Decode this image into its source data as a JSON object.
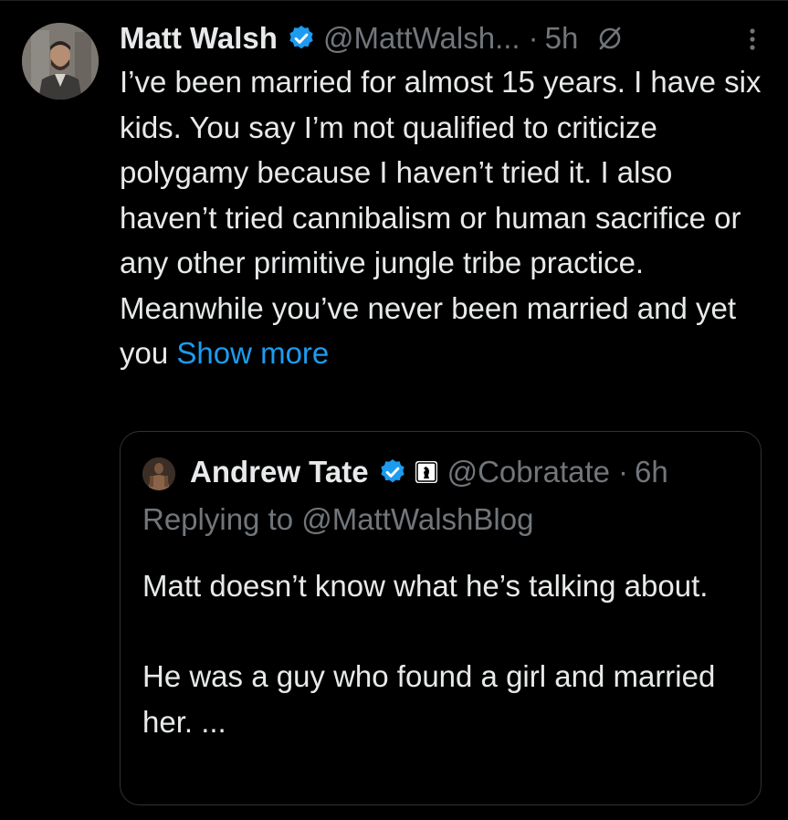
{
  "tweet": {
    "author_name": "Matt Walsh",
    "author_handle": "@MattWalsh...",
    "separator": "·",
    "time": "5h",
    "text": "I’ve been married for almost 15 years. I have six kids. You say I’m not qualified to criticize polygamy because I haven’t tried it. I also haven’t tried cannibalism or human sacrifice or any other primitive jungle tribe practice. Meanwhile you’ve never been married and yet you ",
    "show_more": "Show more",
    "icons": {
      "verified": "verified-badge-icon",
      "no_entry": "no-entry-icon",
      "more": "more-vertical-icon"
    }
  },
  "quoted_tweet": {
    "author_name": "Andrew Tate",
    "author_handle": "@Cobratate",
    "separator": "·",
    "time": "6h",
    "replying_to": "Replying to @MattWalshBlog",
    "paragraph_1": "Matt doesn’t know what he’s talking about.",
    "paragraph_2": "He was a guy who found a girl and married her. ...",
    "icons": {
      "verified": "verified-badge-icon",
      "affiliation": "affiliation-badge-icon"
    }
  },
  "colors": {
    "background": "#000000",
    "text_primary": "#e7e9ea",
    "text_secondary": "#71767b",
    "link": "#1d9bf0",
    "verified": "#1d9bf0",
    "border": "#2f3336"
  }
}
